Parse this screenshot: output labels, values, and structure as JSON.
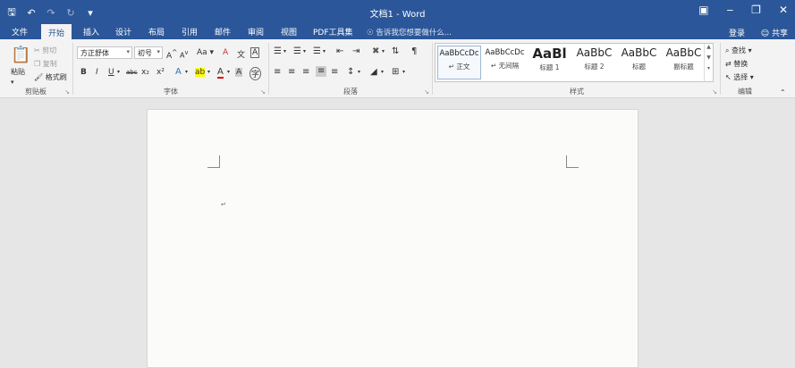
{
  "window": {
    "title": "文档1 - Word"
  },
  "qat": {
    "save_icon": "save-icon",
    "undo_icon": "undo-icon",
    "redo_icon": "redo-icon",
    "repeat_icon": "repeat-icon",
    "customize_icon": "customize-icon"
  },
  "tabs": [
    {
      "label": "文件"
    },
    {
      "label": "开始"
    },
    {
      "label": "插入"
    },
    {
      "label": "设计"
    },
    {
      "label": "布局"
    },
    {
      "label": "引用"
    },
    {
      "label": "邮件"
    },
    {
      "label": "审阅"
    },
    {
      "label": "视图"
    },
    {
      "label": "PDF工具集"
    }
  ],
  "tell_me": "告诉我您想要做什么...",
  "account": {
    "login": "登录",
    "share": "共享"
  },
  "ribbon": {
    "clipboard": {
      "label": "剪贴板",
      "paste": "粘贴",
      "cut": "剪切",
      "copy": "复制",
      "format_painter": "格式刷"
    },
    "font": {
      "label": "字体",
      "font_name": "方正舒体",
      "font_size": "初号",
      "bold": "B",
      "italic": "I",
      "underline": "U",
      "strike": "abc",
      "sub": "x₂",
      "sup": "x²",
      "grow": "A",
      "shrink": "A",
      "case": "Aa",
      "clear": "A",
      "wen": "文",
      "char_border": "A",
      "text_effect": "A",
      "highlight": "ab",
      "font_color": "A",
      "enclose": "字"
    },
    "paragraph": {
      "label": "段落"
    },
    "styles": {
      "label": "样式",
      "items": [
        {
          "preview": "AaBbCcDc",
          "name": "↵ 正文"
        },
        {
          "preview": "AaBbCcDc",
          "name": "↵ 无间隔"
        },
        {
          "preview": "AaBl",
          "name": "标题 1"
        },
        {
          "preview": "AaBbC",
          "name": "标题 2"
        },
        {
          "preview": "AaBbC",
          "name": "标题"
        },
        {
          "preview": "AaBbC",
          "name": "副标题"
        }
      ]
    },
    "editing": {
      "label": "编辑",
      "find": "查找",
      "replace": "替换",
      "select": "选择"
    }
  },
  "document": {
    "paragraph_mark": "↵"
  }
}
